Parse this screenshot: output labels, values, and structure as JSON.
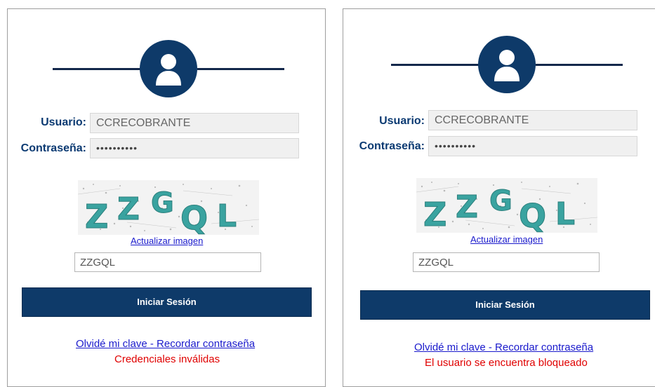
{
  "panels": [
    {
      "user_label": "Usuario:",
      "user_value": "CCRECOBRANTE",
      "password_label": "Contraseña:",
      "password_value": "••••••••••",
      "captcha_text": "ZZGQL",
      "refresh_label": "Actualizar imagen",
      "captcha_input_value": "ZZGQL",
      "login_label": "Iniciar Sesión",
      "forgot_label": "Olvidé mi clave - Recordar contraseña",
      "error_message": "Credenciales inválidas"
    },
    {
      "user_label": "Usuario:",
      "user_value": "CCRECOBRANTE",
      "password_label": "Contraseña:",
      "password_value": "••••••••••",
      "captcha_text": "ZZGQL",
      "refresh_label": "Actualizar imagen",
      "captcha_input_value": "ZZGQL",
      "login_label": "Iniciar Sesión",
      "forgot_label": "Olvidé mi clave - Recordar contraseña",
      "error_message": "El usuario se encuentra bloqueado"
    }
  ],
  "icons": {
    "avatar": "user-silhouette-icon"
  },
  "colors": {
    "primary_navy": "#0e3a69",
    "label_blue": "#0b3a72",
    "link_blue": "#1a1acc",
    "error_red": "#e00000",
    "captcha_teal": "#3aa3a0"
  }
}
